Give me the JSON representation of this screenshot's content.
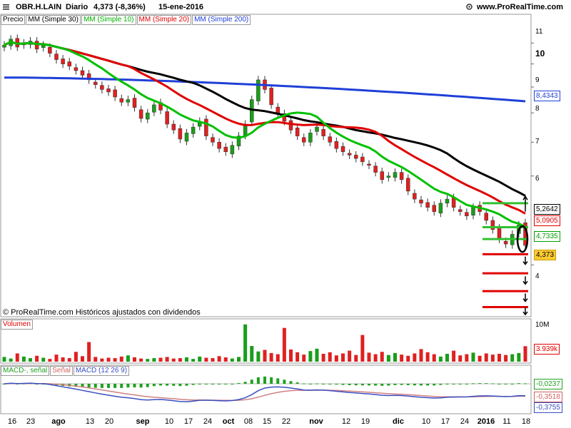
{
  "header": {
    "symbol": "OBR.H.LAIN",
    "period": "Diario",
    "quote": "4,373 (-8,36%)",
    "date": "15-ene-2016",
    "site": "www.ProRealTime.com"
  },
  "legend": {
    "price": "Precio",
    "ma30": "MM (Simple 30)",
    "ma10": "MM (Simple 10)",
    "ma20": "MM (Simple 20)",
    "ma200": "MM (Simple 200)"
  },
  "colors": {
    "up": "#1a9e1a",
    "down": "#e02020",
    "ma10": "#00c000",
    "ma20": "#e00000",
    "ma30": "#000000",
    "ma200": "#1f3fd8",
    "volume": "#e02020",
    "macd_hist": "#20a020",
    "macd_line": "#3a4fc0",
    "signal_line": "#d08080"
  },
  "panels": {
    "volume_label": "Volumen",
    "macd_label_1": "MACD-, señal",
    "macd_label_2": "Señal",
    "macd_label_3": "MACD (12 26 9)"
  },
  "watermark": "© ProRealTime.com  Históricos ajustados con dividendos",
  "price_tags": {
    "ma200": "8,4343",
    "ma30": "5,2642",
    "ma20": "5,0905",
    "ma10": "4,7335",
    "last": "4,373"
  },
  "volume_tags": {
    "max": "10M",
    "last": "3.939k"
  },
  "macd_tags": {
    "hist": "-0,0237",
    "signal": "-0,3518",
    "macd": "-0,3755"
  },
  "chart_data": [
    {
      "type": "candlestick",
      "ylim": [
        3.2,
        11.6
      ],
      "y_scale": "log",
      "y_ticks": [
        {
          "label": "11",
          "value": 11
        },
        {
          "label": "10",
          "value": 10
        },
        {
          "label": "9",
          "value": 9
        },
        {
          "label": "8",
          "value": 8
        },
        {
          "label": "7",
          "value": 7
        },
        {
          "label": "6",
          "value": 6
        },
        {
          "label": "4",
          "value": 4
        }
      ],
      "x_ticks": [
        "16",
        "23",
        "ago",
        "13",
        "20",
        "sep",
        "10",
        "17",
        "24",
        "oct",
        "08",
        "15",
        "22",
        "nov",
        "12",
        "19",
        "dic",
        "10",
        "17",
        "24",
        "2016",
        "11",
        "18"
      ],
      "close": [
        10.9,
        11.2,
        10.8,
        11.0,
        11.1,
        10.7,
        10.9,
        10.5,
        10.2,
        10.0,
        9.9,
        9.7,
        9.5,
        9.3,
        9.1,
        8.9,
        8.8,
        8.6,
        8.4,
        8.5,
        8.2,
        7.8,
        8.0,
        8.3,
        8.1,
        7.6,
        7.4,
        7.1,
        7.3,
        7.5,
        7.7,
        7.2,
        7.0,
        6.8,
        6.7,
        6.9,
        7.2,
        7.6,
        8.5,
        9.3,
        8.9,
        8.3,
        8.0,
        7.7,
        7.4,
        7.2,
        7.0,
        7.3,
        7.5,
        7.2,
        7.0,
        6.8,
        6.7,
        6.6,
        6.5,
        6.4,
        6.3,
        6.1,
        5.9,
        6.0,
        6.1,
        5.9,
        5.6,
        5.4,
        5.3,
        5.2,
        5.1,
        5.3,
        5.4,
        5.2,
        5.1,
        5.0,
        5.2,
        5.1,
        4.9,
        4.7,
        4.5,
        4.4,
        4.6,
        4.8,
        4.373
      ],
      "ma10_last": 4.7335,
      "ma20_last": 5.0905,
      "ma30_last": 5.2642,
      "ma200_last": 8.4343,
      "horizontal_lines": [
        {
          "value": 5.3,
          "color": "green"
        },
        {
          "value": 4.75,
          "color": "green"
        },
        {
          "value": 4.5,
          "color": "green"
        },
        {
          "value": 4.2,
          "color": "red"
        },
        {
          "value": 3.85,
          "color": "red"
        },
        {
          "value": 3.55,
          "color": "red"
        },
        {
          "value": 3.3,
          "color": "red"
        }
      ]
    },
    {
      "type": "bar",
      "title": "Volumen",
      "y_ticks": [
        {
          "label": "10M",
          "value": 10000000
        }
      ],
      "last_value": 3939000,
      "values_millions": [
        1.2,
        0.8,
        2.1,
        1.3,
        0.9,
        1.5,
        1.0,
        0.7,
        1.8,
        1.1,
        0.9,
        2.5,
        1.4,
        5.0,
        1.2,
        0.8,
        1.0,
        0.9,
        1.3,
        1.6,
        1.1,
        0.8,
        0.7,
        0.9,
        1.0,
        1.2,
        0.8,
        0.9,
        1.1,
        0.7,
        1.3,
        1.0,
        0.9,
        1.4,
        1.1,
        0.8,
        1.2,
        9.5,
        4.0,
        2.6,
        3.0,
        2.2,
        1.9,
        8.6,
        3.1,
        2.4,
        1.8,
        2.7,
        3.3,
        2.0,
        2.4,
        1.6,
        2.1,
        2.8,
        1.7,
        6.8,
        2.3,
        1.9,
        2.5,
        1.7,
        2.2,
        1.8,
        1.5,
        2.1,
        3.2,
        2.4,
        1.9,
        1.3,
        2.0,
        2.8,
        1.6,
        1.9,
        2.3,
        1.5,
        2.1,
        1.8,
        2.0,
        1.7,
        1.9,
        2.2,
        3.939
      ]
    },
    {
      "type": "line",
      "title": "MACD (12 26 9)",
      "series": [
        {
          "name": "MACD (12 26 9)",
          "last": -0.3755
        },
        {
          "name": "Señal",
          "last": -0.3518
        },
        {
          "name": "MACD-, señal",
          "last": -0.0237
        }
      ]
    }
  ],
  "x_labels": [
    "16",
    "23",
    "ago",
    "13",
    "20",
    "sep",
    "10",
    "17",
    "24",
    "oct",
    "08",
    "15",
    "22",
    "nov",
    "12",
    "19",
    "dic",
    "10",
    "17",
    "24",
    "2016",
    "11",
    "18"
  ]
}
